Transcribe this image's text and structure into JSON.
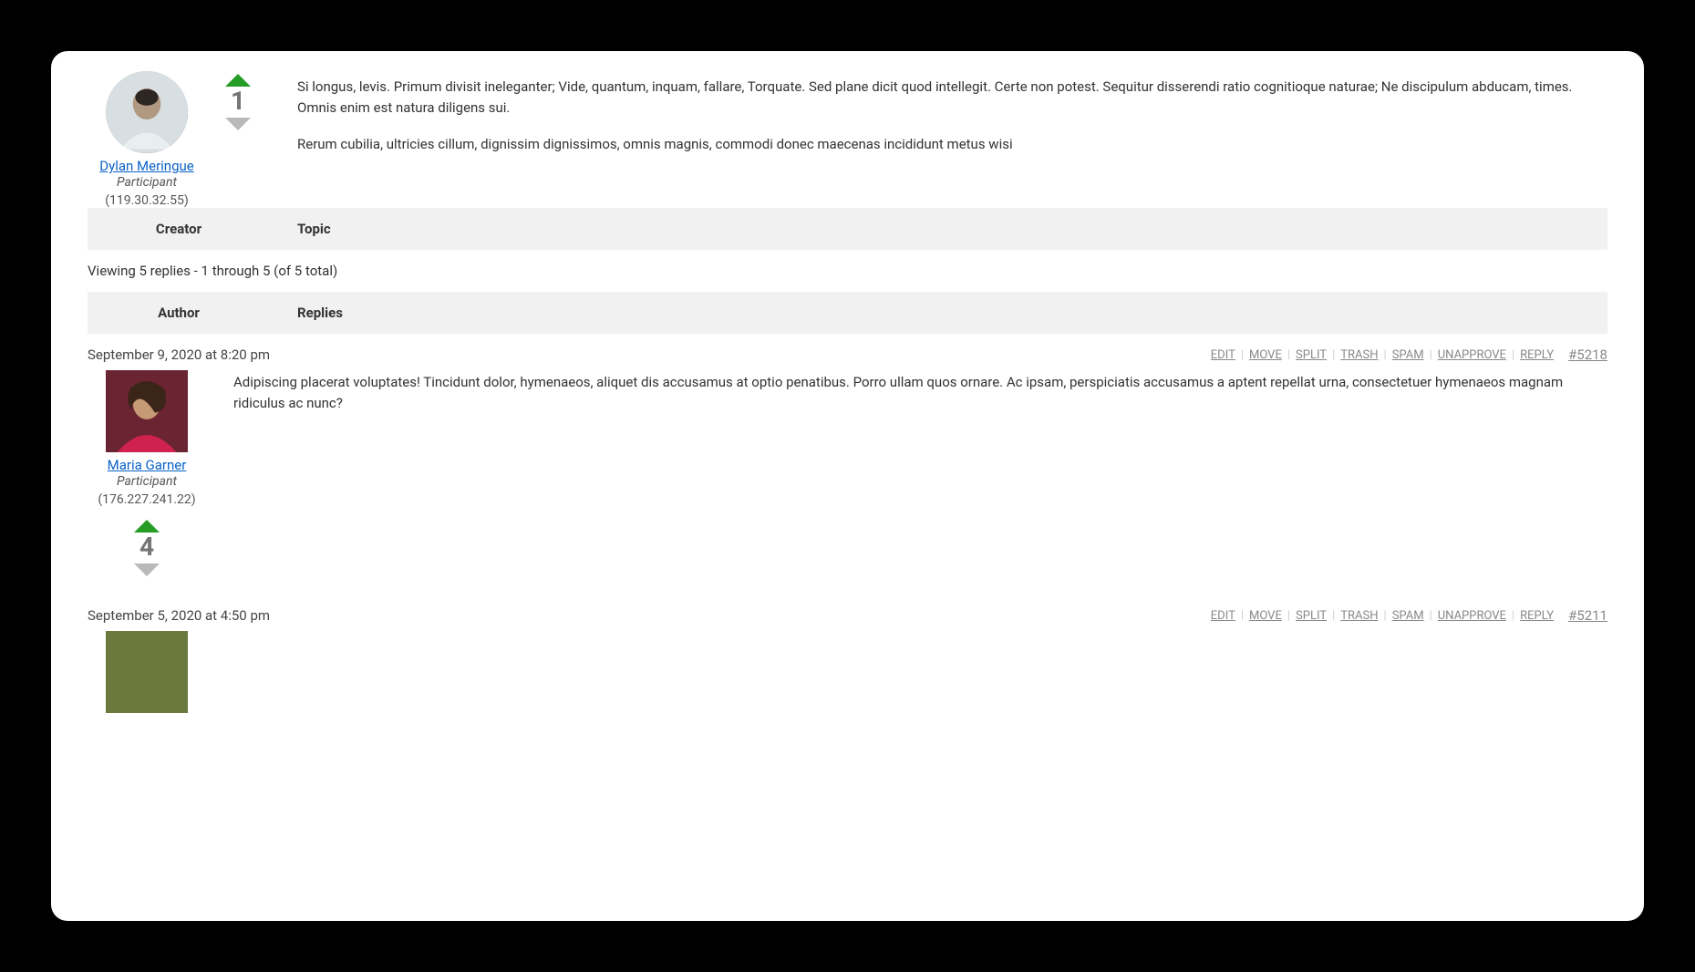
{
  "topic": {
    "author": {
      "name": "Dylan Meringue",
      "role": "Participant",
      "ip": "(119.30.32.55)"
    },
    "vote_count": "1",
    "paragraphs": [
      "Si longus, levis. Primum divisit ineleganter; Vide, quantum, inquam, fallare, Torquate. Sed plane dicit quod intellegit. Certe non potest. Sequitur disserendi ratio cognitioque naturae; Ne discipulum abducam, times. Omnis enim est natura diligens sui.",
      "Rerum cubilia, ultricies cillum, dignissim dignissimos, omnis magnis, commodi donec maecenas incididunt metus wisi"
    ]
  },
  "headers": {
    "creator": "Creator",
    "topic": "Topic",
    "author": "Author",
    "replies": "Replies"
  },
  "viewing_line": "Viewing 5 replies - 1 through 5 (of 5 total)",
  "actions": {
    "edit": "EDIT",
    "move": "MOVE",
    "split": "SPLIT",
    "trash": "TRASH",
    "spam": "SPAM",
    "unapprove": "UNAPPROVE",
    "reply": "REPLY"
  },
  "replies": [
    {
      "timestamp": "September 9, 2020 at 8:20 pm",
      "permalink": "#5218",
      "author": {
        "name": "Maria Garner",
        "role": "Participant",
        "ip": "(176.227.241.22)"
      },
      "vote_count": "4",
      "body": "Adipiscing placerat voluptates! Tincidunt dolor, hymenaeos, aliquet dis accusamus at optio penatibus. Porro ullam quos ornare. Ac ipsam, perspiciatis accusamus a aptent repellat urna, consectetuer hymenaeos magnam ridiculus ac nunc?"
    },
    {
      "timestamp": "September 5, 2020 at 4:50 pm",
      "permalink": "#5211",
      "author": {
        "name": "",
        "role": "",
        "ip": ""
      },
      "vote_count": "",
      "body": ""
    }
  ]
}
